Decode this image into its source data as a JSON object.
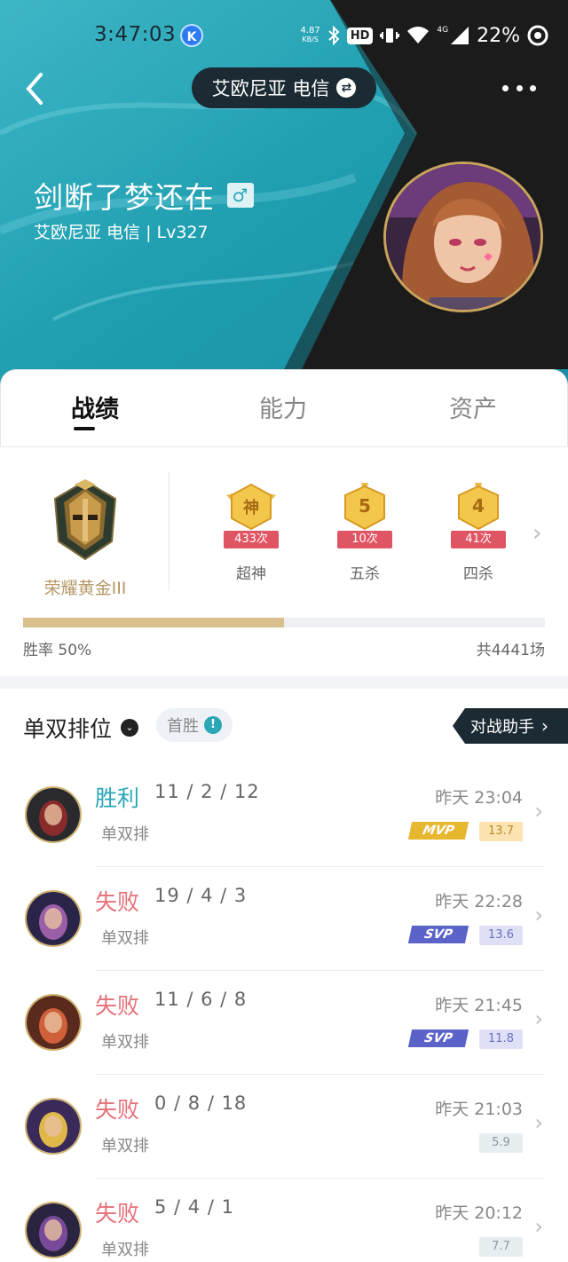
{
  "status": {
    "time": "3:47:03",
    "k_badge": "K",
    "net_speed_value": "4.87",
    "net_speed_unit": "KB/S",
    "hd": "HD",
    "network": "4G",
    "battery": "22%"
  },
  "header": {
    "server_label": "艾欧尼亚 电信",
    "player_name": "剑断了梦还在",
    "gender_symbol": "♂",
    "subtitle": "艾欧尼亚 电信 | Lv327"
  },
  "tabs": [
    "战绩",
    "能力",
    "资产"
  ],
  "rank": {
    "name": "荣耀黄金III",
    "achievements": [
      {
        "glyph": "神",
        "count": "433次",
        "label": "超神"
      },
      {
        "glyph": "5",
        "count": "10次",
        "label": "五杀"
      },
      {
        "glyph": "4",
        "count": "41次",
        "label": "四杀"
      }
    ],
    "win_rate_text": "胜率 50%",
    "win_rate_fraction": 0.5,
    "total_text": "共4441场"
  },
  "list": {
    "queue_title": "单双排位",
    "first_win": "首胜",
    "assist_label": "对战助手"
  },
  "matches": [
    {
      "result": "胜利",
      "outcome": "win",
      "kda": "11 / 2 / 12",
      "queue": "单双排",
      "time": "昨天 23:04",
      "badge": "MVP",
      "score": "13.7"
    },
    {
      "result": "失败",
      "outcome": "lose",
      "kda": "19 / 4 / 3",
      "queue": "单双排",
      "time": "昨天 22:28",
      "badge": "SVP",
      "score": "13.6"
    },
    {
      "result": "失败",
      "outcome": "lose",
      "kda": "11 / 6 / 8",
      "queue": "单双排",
      "time": "昨天 21:45",
      "badge": "SVP",
      "score": "11.8"
    },
    {
      "result": "失败",
      "outcome": "lose",
      "kda": "0 / 8 / 18",
      "queue": "单双排",
      "time": "昨天 21:03",
      "badge": "",
      "score": "5.9"
    },
    {
      "result": "失败",
      "outcome": "lose",
      "kda": "5 / 4 / 1",
      "queue": "单双排",
      "time": "昨天 20:12",
      "badge": "",
      "score": "7.7"
    }
  ],
  "colors": {
    "accent": "#2aa6b6",
    "lose": "#e7717a",
    "gold": "#d9bf8b",
    "dark": "#1c2b33"
  }
}
